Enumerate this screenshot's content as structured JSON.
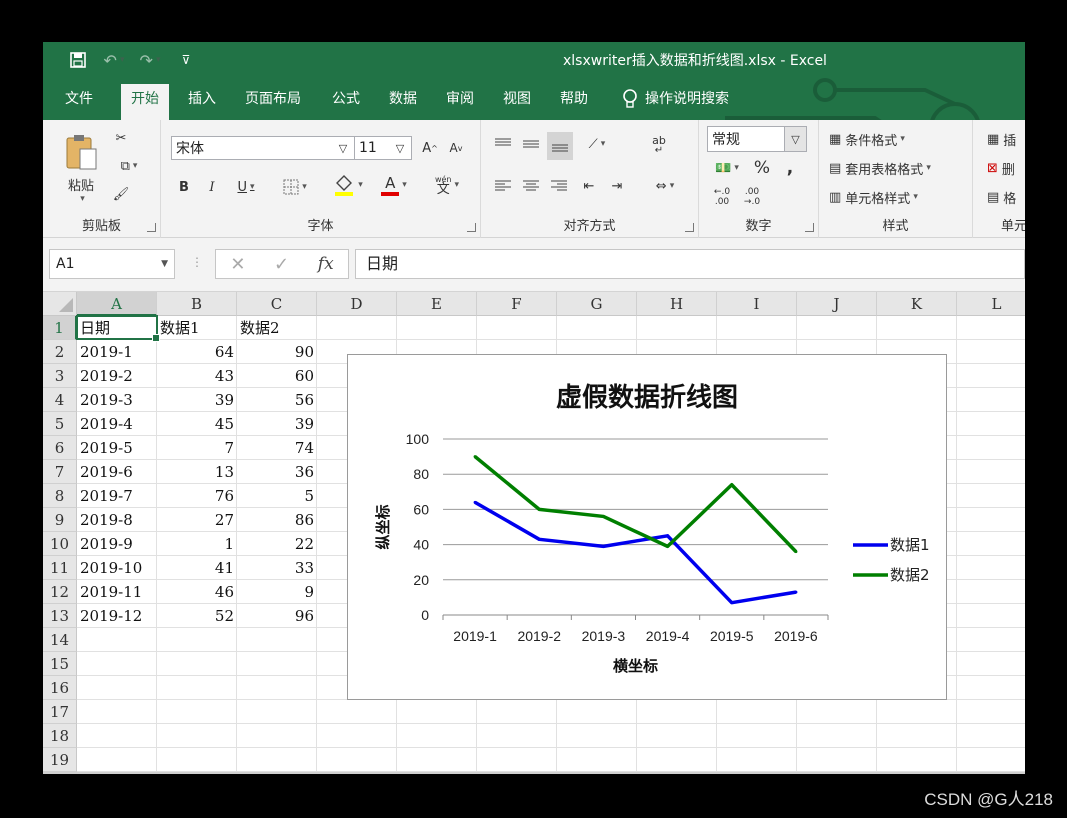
{
  "window": {
    "title": "xlsxwriter插入数据和折线图.xlsx  -  Excel"
  },
  "quick_access": {
    "save_icon": "save-icon",
    "undo_icon": "undo-icon",
    "redo_icon": "redo-icon",
    "customize_icon": "customize-qat-icon"
  },
  "tabs": [
    {
      "label": "文件"
    },
    {
      "label": "开始"
    },
    {
      "label": "插入"
    },
    {
      "label": "页面布局"
    },
    {
      "label": "公式"
    },
    {
      "label": "数据"
    },
    {
      "label": "审阅"
    },
    {
      "label": "视图"
    },
    {
      "label": "帮助"
    }
  ],
  "tell_me": "操作说明搜索",
  "ribbon": {
    "clipboard": {
      "paste": "粘贴",
      "label": "剪贴板"
    },
    "font": {
      "name": "宋体",
      "size": "11",
      "label": "字体",
      "bold": "B",
      "italic": "I",
      "underline": "U",
      "grow": "A",
      "shrink": "A",
      "font_color": "A",
      "phonetic": "wén",
      "phonetic_char": "文"
    },
    "alignment": {
      "label": "对齐方式",
      "wrap": "ab"
    },
    "number": {
      "format": "常规",
      "label": "数字",
      "percent": "%",
      "comma": ",",
      "inc_decimal": "←.0\n.00",
      "dec_decimal": ".00\n→.0"
    },
    "styles": {
      "conditional": "条件格式",
      "table": "套用表格格式",
      "cell": "单元格样式",
      "label": "样式"
    },
    "cells": {
      "insert": "插",
      "delete": "删",
      "format": "格",
      "label": "单元"
    }
  },
  "formula_bar": {
    "name_box": "A1",
    "cancel": "✕",
    "enter": "✓",
    "fx": "fx",
    "content": "日期"
  },
  "sheet": {
    "columns": [
      "A",
      "B",
      "C",
      "D",
      "E",
      "F",
      "G",
      "H",
      "I",
      "J",
      "K",
      "L"
    ],
    "rows": [
      "1",
      "2",
      "3",
      "4",
      "5",
      "6",
      "7",
      "8",
      "9",
      "10",
      "11",
      "12",
      "13",
      "14",
      "15",
      "16",
      "17",
      "18",
      "19"
    ],
    "cells": [
      [
        "日期",
        "数据1",
        "数据2"
      ],
      [
        "2019-1",
        "64",
        "90"
      ],
      [
        "2019-2",
        "43",
        "60"
      ],
      [
        "2019-3",
        "39",
        "56"
      ],
      [
        "2019-4",
        "45",
        "39"
      ],
      [
        "2019-5",
        "7",
        "74"
      ],
      [
        "2019-6",
        "13",
        "36"
      ],
      [
        "2019-7",
        "76",
        "5"
      ],
      [
        "2019-8",
        "27",
        "86"
      ],
      [
        "2019-9",
        "1",
        "22"
      ],
      [
        "2019-10",
        "41",
        "33"
      ],
      [
        "2019-11",
        "46",
        "9"
      ],
      [
        "2019-12",
        "52",
        "96"
      ]
    ]
  },
  "chart_data": {
    "type": "line",
    "title": "虚假数据折线图",
    "xlabel": "横坐标",
    "ylabel": "纵坐标",
    "categories": [
      "2019-1",
      "2019-2",
      "2019-3",
      "2019-4",
      "2019-5",
      "2019-6"
    ],
    "series": [
      {
        "name": "数据1",
        "values": [
          64,
          43,
          39,
          45,
          7,
          13
        ],
        "color": "#0000ee"
      },
      {
        "name": "数据2",
        "values": [
          90,
          60,
          56,
          39,
          74,
          36
        ],
        "color": "#007f00"
      }
    ],
    "ylim": [
      0,
      100
    ],
    "yticks": [
      "0",
      "20",
      "40",
      "60",
      "80",
      "100"
    ],
    "grid": true,
    "legend_position": "right"
  },
  "watermark": "CSDN @G人218"
}
